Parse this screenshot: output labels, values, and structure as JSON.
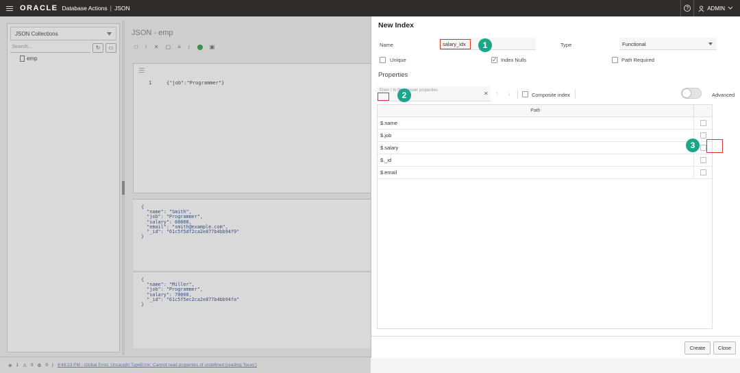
{
  "topbar": {
    "logo": "ORACLE",
    "product": "Database Actions",
    "separator": "|",
    "crumb": "JSON",
    "help": "?",
    "user": "ADMIN"
  },
  "sidebar": {
    "title": "JSON Collections",
    "search_placeholder": "Search...",
    "collections": [
      "emp"
    ]
  },
  "editor": {
    "title": "JSON - emp",
    "query_line_number": "1",
    "query": "{\"job\":\"Programmer\"}",
    "documents": [
      "{\n  \"name\": \"Smith\",\n  \"job\": \"Programmer\",\n  \"salary\": 60000,\n  \"email\": \"smith@example.com\",\n  \"_id\": \"61c5f5df2ca2e877b4bb94f9\"\n}",
      "{\n  \"name\": \"Miller\",\n  \"job\": \"Programmer\",\n  \"salary\": 70000,\n  \"_id\": \"61c5f5ec2ca2e877b4bb94fa\"\n}"
    ]
  },
  "statusbar": {
    "errors": "1",
    "warnings": "0",
    "settings": "0",
    "message": "4:46:13 PM - Global Error: Uncaught TypeError: Cannot read properties of undefined (reading 'focus')"
  },
  "dialog": {
    "title": "New Index",
    "name_label": "Name",
    "name_value": "salary_idx",
    "type_label": "Type",
    "type_value": "Functional",
    "unique_label": "Unique",
    "unique_checked": false,
    "index_nulls_label": "Index Nulls",
    "index_nulls_checked": true,
    "path_required_label": "Path Required",
    "path_required_checked": false,
    "properties_heading": "Properties",
    "filter_placeholder": "Enter / to filter known properties",
    "composite_label": "Composite index",
    "advanced_label": "Advanced",
    "table_header": "Path",
    "paths": [
      "$.name",
      "$.job",
      "$.salary",
      "$._id",
      "$.email"
    ],
    "create_label": "Create",
    "close_label": "Close"
  },
  "markers": [
    "1",
    "2",
    "3"
  ],
  "colors": {
    "topbar": "#312d2a",
    "highlight": "#d9312b",
    "marker": "#1ba58a",
    "run": "#1c9c3a"
  }
}
